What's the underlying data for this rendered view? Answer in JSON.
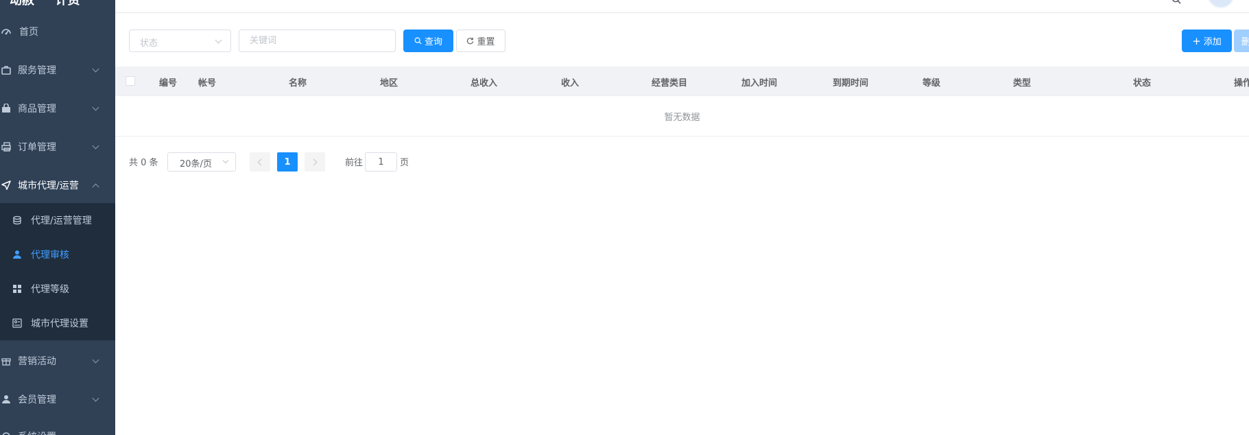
{
  "sidebar": {
    "title": "动赦 一 计资",
    "items": [
      {
        "label": "首页",
        "icon": "dashboard-icon"
      },
      {
        "label": "服务管理",
        "icon": "settings-icon"
      },
      {
        "label": "商品管理",
        "icon": "shopping-bag-icon"
      },
      {
        "label": "订单管理",
        "icon": "printer-icon"
      },
      {
        "label": "城市代理/运营",
        "icon": "location-arrow-icon"
      },
      {
        "label": "营销活动",
        "icon": "gift-icon"
      },
      {
        "label": "会员管理",
        "icon": "user-icon"
      },
      {
        "label": "系统设置",
        "icon": "settings-gear-icon"
      }
    ],
    "submenu": [
      {
        "label": "代理/运营管理",
        "icon": "coins-icon"
      },
      {
        "label": "代理审核",
        "icon": "user-icon",
        "active": true
      },
      {
        "label": "代理等级",
        "icon": "grid-icon"
      },
      {
        "label": "城市代理设置",
        "icon": "settings-panel-icon"
      }
    ],
    "active_color": "#409eff"
  },
  "filters": {
    "status_placeholder": "状态",
    "keyword_placeholder": "关键词",
    "search_label": "查询",
    "reset_label": "重置",
    "add_label": "添加",
    "delete_label": "删"
  },
  "table": {
    "columns": [
      "编号",
      "帐号",
      "名称",
      "地区",
      "总收入",
      "收入",
      "经营类目",
      "加入时间",
      "到期时间",
      "等级",
      "类型",
      "状态",
      "操作"
    ],
    "empty_text": "暂无数据"
  },
  "pagination": {
    "total_text": "共 0 条",
    "page_size": "20条/页",
    "current_page": "1",
    "goto_label": "前往",
    "goto_value": "1",
    "page_unit": "页"
  },
  "colors": {
    "primary": "#1890ff",
    "sidebar_bg": "#304156",
    "submenu_bg": "#1f2d3d"
  }
}
